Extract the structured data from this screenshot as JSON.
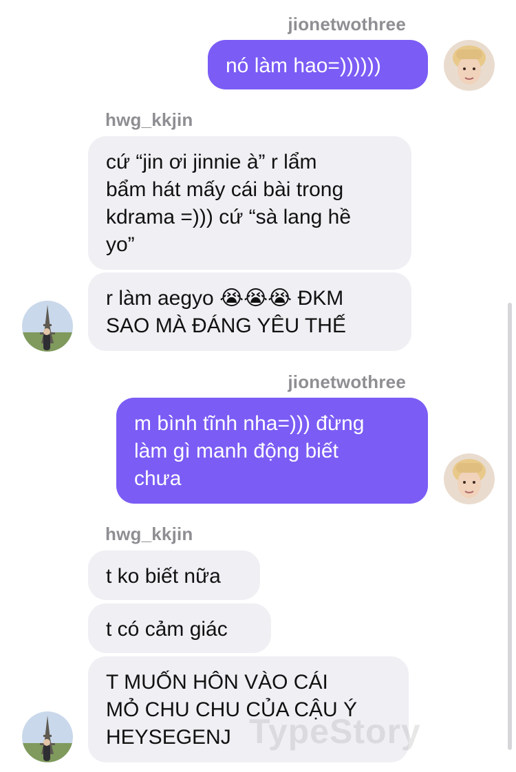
{
  "messages": [
    {
      "sender": "jionetwothree",
      "text": "nó làm hao=))))))"
    },
    {
      "sender": "hwg_kkjin",
      "text": "cứ “jin ơi jinnie à” r lẩm\nbẩm hát mấy cái bài trong\nkdrama =))) cứ “sà lang hề\nyo”"
    },
    {
      "sender": "hwg_kkjin",
      "text": "r làm aegyo 😭😭😭 ĐKM\nSAO MÀ ĐÁNG YÊU THẾ"
    },
    {
      "sender": "jionetwothree",
      "text": "m bình tĩnh nha=))) đừng\nlàm gì manh động biết\nchưa"
    },
    {
      "sender": "hwg_kkjin",
      "text": "t ko biết nữa"
    },
    {
      "sender": "hwg_kkjin",
      "text": "t có cảm giác"
    },
    {
      "sender": "hwg_kkjin",
      "text": "T MUỐN HÔN VÀO CÁI\nMỎ CHU CHU CỦA CẬU Ý\nHEYSEGENJ"
    }
  ],
  "watermark": "TypeStory",
  "colors": {
    "outgoing_bubble": "#7b5cf5",
    "incoming_bubble": "#efeff4",
    "username": "#8e8e93"
  }
}
